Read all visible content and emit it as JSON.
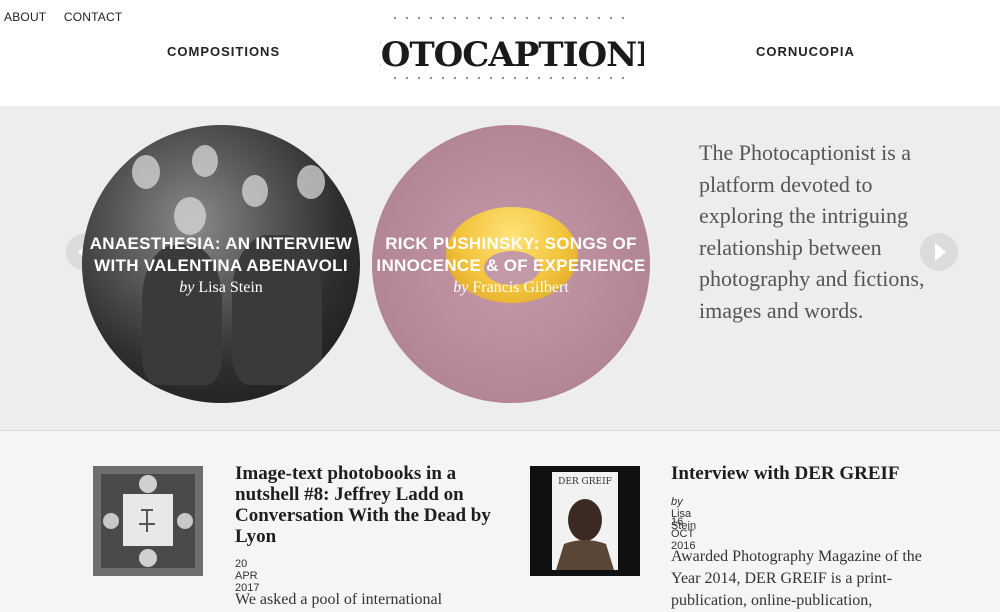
{
  "header": {
    "links": [
      "ABOUT",
      "CONTACT"
    ],
    "nav_left": "COMPOSITIONS",
    "nav_right": "CORNUCOPIA",
    "logo": "PHOTOCAPTIONIST"
  },
  "slider": {
    "slides": [
      {
        "title": "ANAESTHESIA: AN INTERVIEW WITH VALENTINA ABENAVOLI",
        "by": "by",
        "author": "Lisa Stein"
      },
      {
        "title": "RICK PUSHINSKY: SONGS OF INNOCENCE & OF EXPERIENCE",
        "by": "by",
        "author": "Francis Gilbert"
      }
    ],
    "intro": "The Photocaptionist is a platform devoted to exploring the intriguing relationship between photography and fictions, images and words."
  },
  "posts": [
    {
      "title": "Image-text photobooks in a nutshell #8: Jeffrey Ladd on Conversation With the Dead by Lyon",
      "date": "20 APR 2017",
      "excerpt": "We asked a pool of international"
    },
    {
      "title": "Interview with DER GREIF",
      "by": "by",
      "author": "Lisa Stein",
      "date": "16 OCT 2016",
      "thumb_label": "DER GREIF",
      "excerpt": "Awarded Photography Magazine of the Year 2014, DER GREIF is a print-publication, online-publication,"
    }
  ]
}
